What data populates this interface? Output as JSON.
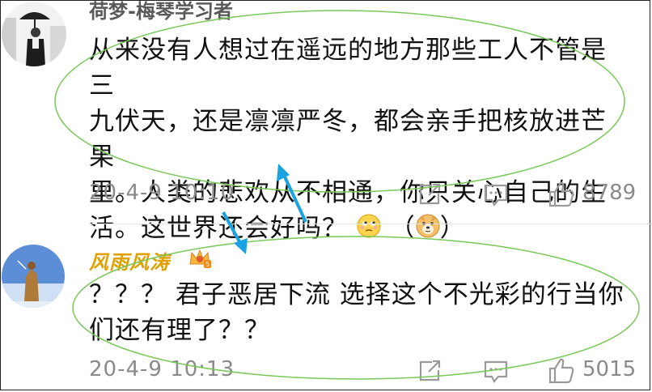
{
  "comments": [
    {
      "username": "荷梦-梅琴学习者",
      "text_lines": [
        "从来没有人想过在遥远的地方那些工人不管是三",
        "九伏天，还是凛凛严冬，都会亲手把核放进芒果",
        "里。人类的悲欢从不相通，你只关心自己的生",
        "活。这世界还会好吗？"
      ],
      "emoji_1": "pondering-face",
      "emoji_2": "doge-face",
      "paren_open": "（",
      "paren_close": "）",
      "timestamp": "20-4-9 10:10",
      "likes": "8789"
    },
    {
      "username": "风雨风涛",
      "badge": "crown-badge-5",
      "text_lines": [
        "？？？ 君子恶居下流  选择这个不光彩的行当你",
        "们还有理了？？"
      ],
      "timestamp": "20-4-9 10:13",
      "likes": "5015"
    }
  ],
  "colors": {
    "ellipse": "#7ac75a",
    "arrow": "#1aa3e0",
    "username_vip": "#e0a100",
    "meta": "#8a8a8a"
  }
}
